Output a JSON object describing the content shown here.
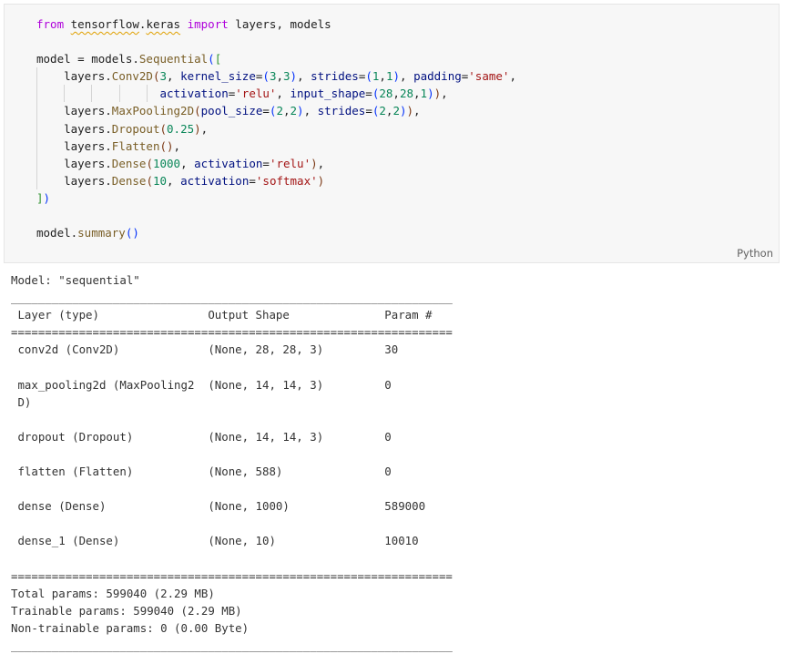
{
  "code_cell": {
    "language_label": "Python",
    "lines": [
      "from tensorflow.keras import layers, models",
      "",
      "model = models.Sequential([",
      "    layers.Conv2D(3, kernel_size=(3,3), strides=(1,1), padding='same',",
      "                  activation='relu', input_shape=(28,28,1)),",
      "    layers.MaxPooling2D(pool_size=(2,2), strides=(2,2)),",
      "    layers.Dropout(0.25),",
      "    layers.Flatten(),",
      "    layers.Dense(1000, activation='relu'),",
      "    layers.Dense(10, activation='softmax')",
      "])",
      "",
      "model.summary()"
    ]
  },
  "output": {
    "lines": [
      "Model: \"sequential\"",
      "_________________________________________________________________",
      " Layer (type)                Output Shape              Param #   ",
      "=================================================================",
      " conv2d (Conv2D)             (None, 28, 28, 3)         30        ",
      "                                                                 ",
      " max_pooling2d (MaxPooling2  (None, 14, 14, 3)         0         ",
      " D)                                                              ",
      "                                                                 ",
      " dropout (Dropout)           (None, 14, 14, 3)         0         ",
      "                                                                 ",
      " flatten (Flatten)           (None, 588)               0         ",
      "                                                                 ",
      " dense (Dense)               (None, 1000)              589000    ",
      "                                                                 ",
      " dense_1 (Dense)             (None, 10)                10010     ",
      "                                                                 ",
      "=================================================================",
      "Total params: 599040 (2.29 MB)",
      "Trainable params: 599040 (2.29 MB)",
      "Non-trainable params: 0 (0.00 Byte)",
      "_________________________________________________________________"
    ]
  }
}
